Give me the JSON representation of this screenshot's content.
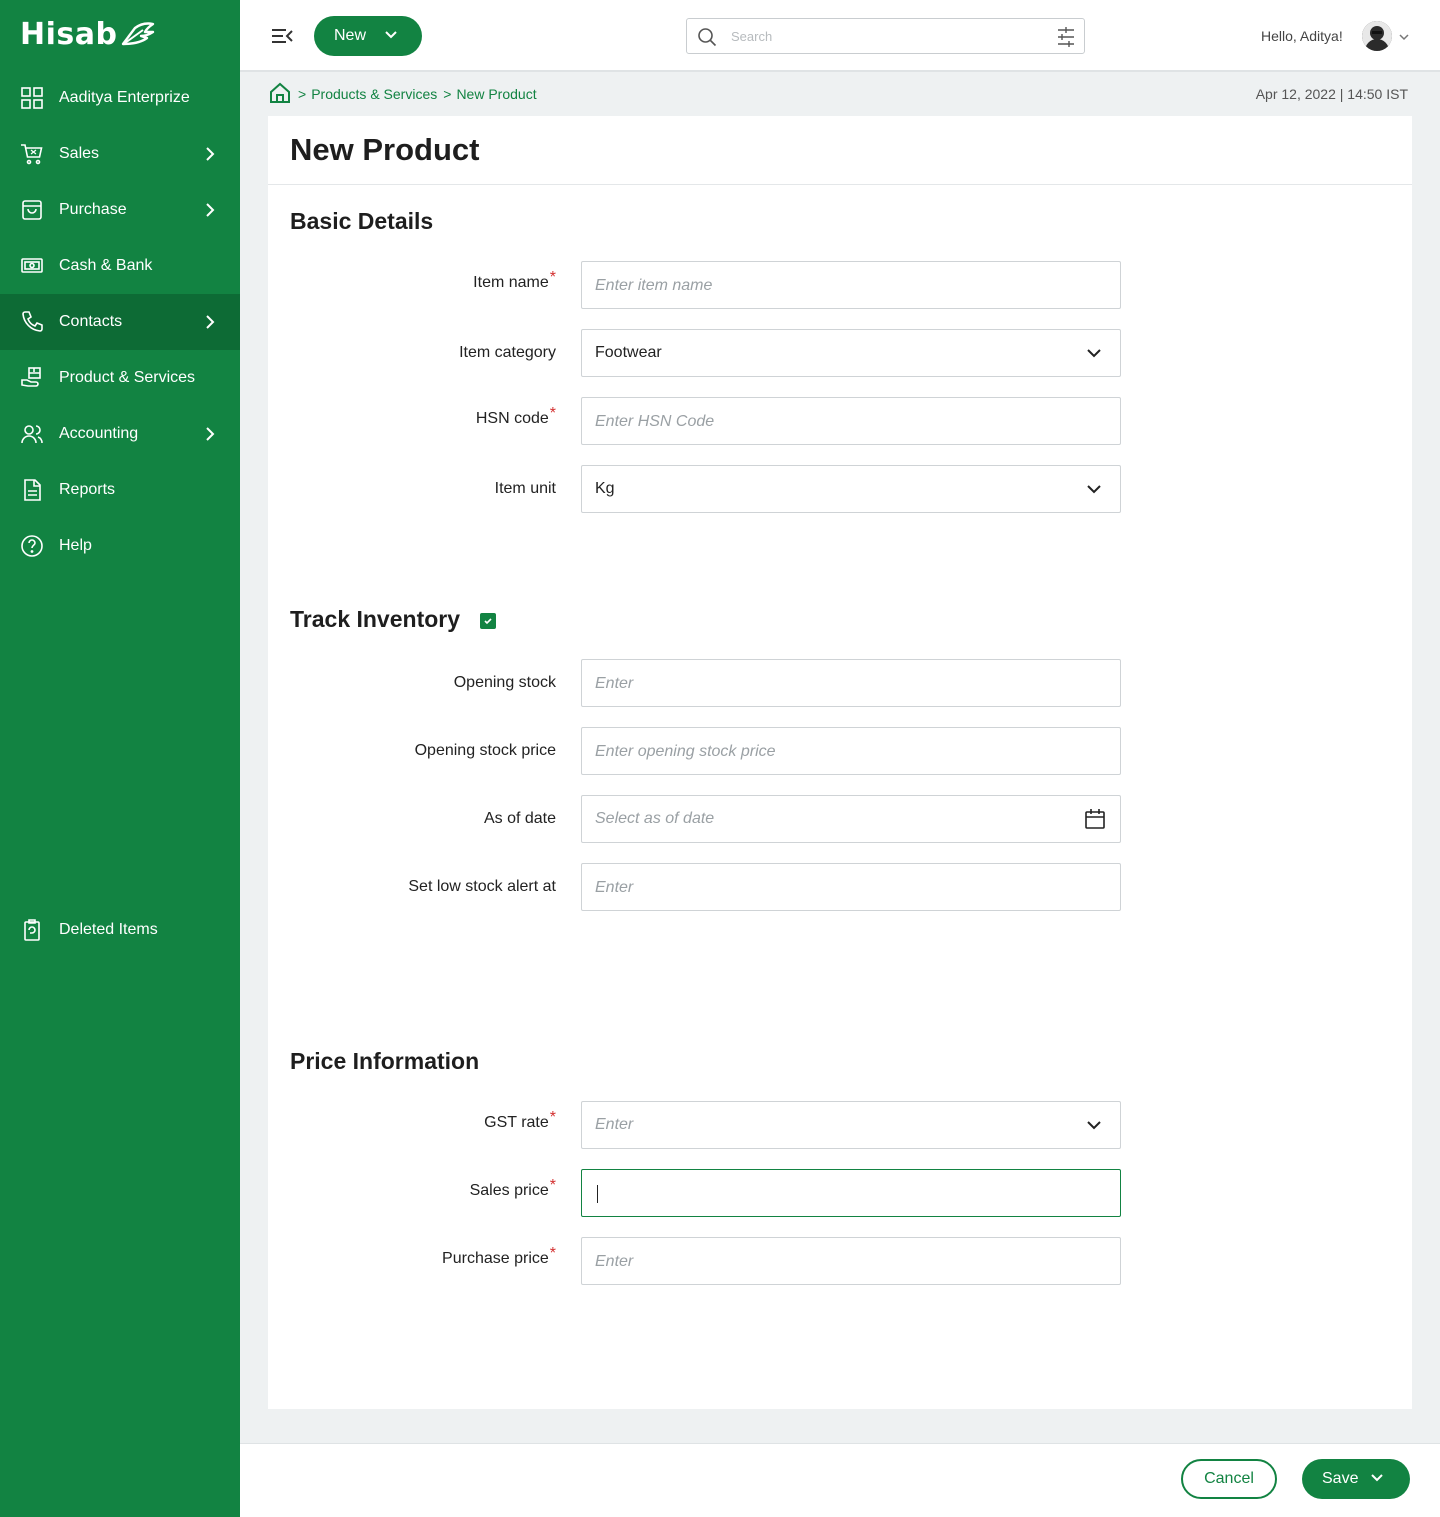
{
  "app": {
    "logo": "Hisab"
  },
  "sidebar": {
    "items": [
      {
        "label": "Aaditya Enterprize",
        "icon": "grid-icon",
        "has_chevron": false
      },
      {
        "label": "Sales",
        "icon": "cart-icon",
        "has_chevron": true
      },
      {
        "label": "Purchase",
        "icon": "bag-icon",
        "has_chevron": true
      },
      {
        "label": "Cash & Bank",
        "icon": "cash-icon",
        "has_chevron": false
      },
      {
        "label": "Contacts",
        "icon": "phone-icon",
        "has_chevron": true,
        "active": true
      },
      {
        "label": "Product & Services",
        "icon": "product-box-icon",
        "has_chevron": false
      },
      {
        "label": "Accounting",
        "icon": "users-icon",
        "has_chevron": true
      },
      {
        "label": "Reports",
        "icon": "document-icon",
        "has_chevron": false
      },
      {
        "label": "Help",
        "icon": "help-circle-icon",
        "has_chevron": false
      }
    ],
    "deleted": {
      "label": "Deleted Items",
      "icon": "trash-icon"
    }
  },
  "topbar": {
    "new_label": "New",
    "search_placeholder": "Search",
    "greeting": "Hello, Aditya!"
  },
  "breadcrumb": {
    "items": [
      "Products & Services",
      "New Product"
    ],
    "separator": ">"
  },
  "datetime": "Apr 12, 2022 | 14:50 IST",
  "page": {
    "title": "New Product",
    "sections": {
      "basic": {
        "title": "Basic Details",
        "item_name": {
          "label": "Item name",
          "required": true,
          "placeholder": "Enter item name"
        },
        "item_category": {
          "label": "Item category",
          "value": "Footwear"
        },
        "hsn_code": {
          "label": "HSN code",
          "required": true,
          "placeholder": "Enter HSN Code"
        },
        "item_unit": {
          "label": "Item unit",
          "value": "Kg"
        }
      },
      "inventory": {
        "title": "Track Inventory",
        "checked": true,
        "opening_stock": {
          "label": "Opening stock",
          "placeholder": "Enter"
        },
        "opening_stock_price": {
          "label": "Opening stock price",
          "placeholder": "Enter opening stock price"
        },
        "as_of_date": {
          "label": "As of date",
          "placeholder": "Select as of date"
        },
        "low_stock": {
          "label": "Set low stock alert at",
          "placeholder": "Enter"
        }
      },
      "price": {
        "title": "Price Information",
        "gst_rate": {
          "label": "GST rate",
          "required": true,
          "placeholder": "Enter"
        },
        "sales_price": {
          "label": "Sales price",
          "required": true,
          "value": ""
        },
        "purchase_price": {
          "label": "Purchase price",
          "required": true,
          "placeholder": "Enter"
        }
      }
    }
  },
  "footer": {
    "cancel_label": "Cancel",
    "save_label": "Save"
  },
  "colors": {
    "brand": "#128342",
    "brand_dark": "#0d6b35",
    "required": "#d32f2f"
  }
}
